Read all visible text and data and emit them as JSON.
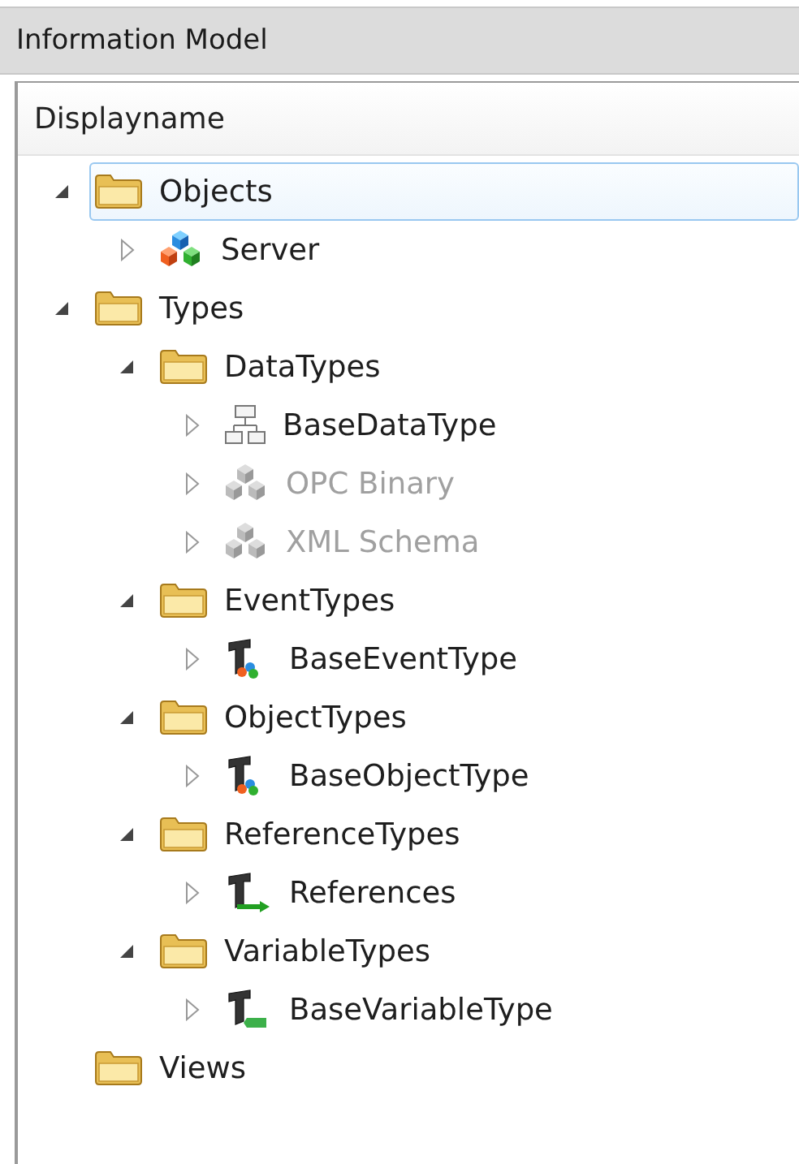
{
  "panel": {
    "title": "Information Model"
  },
  "tree": {
    "column": "Displayname",
    "items": [
      {
        "label": "Objects",
        "kind": "folder",
        "expanded": true,
        "selected": true,
        "disabled": false,
        "children": [
          {
            "label": "Server",
            "kind": "cubes",
            "expanded": false,
            "selected": false,
            "disabled": false
          }
        ]
      },
      {
        "label": "Types",
        "kind": "folder",
        "expanded": true,
        "selected": false,
        "disabled": false,
        "children": [
          {
            "label": "DataTypes",
            "kind": "folder",
            "expanded": true,
            "selected": false,
            "disabled": false,
            "children": [
              {
                "label": "BaseDataType",
                "kind": "hierarchy",
                "expanded": false,
                "selected": false,
                "disabled": false
              },
              {
                "label": "OPC Binary",
                "kind": "cubes",
                "expanded": false,
                "selected": false,
                "disabled": true
              },
              {
                "label": "XML Schema",
                "kind": "cubes",
                "expanded": false,
                "selected": false,
                "disabled": true
              }
            ]
          },
          {
            "label": "EventTypes",
            "kind": "folder",
            "expanded": true,
            "selected": false,
            "disabled": false,
            "children": [
              {
                "label": "BaseEventType",
                "kind": "type-cubes",
                "expanded": false,
                "selected": false,
                "disabled": false
              }
            ]
          },
          {
            "label": "ObjectTypes",
            "kind": "folder",
            "expanded": true,
            "selected": false,
            "disabled": false,
            "children": [
              {
                "label": "BaseObjectType",
                "kind": "type-cubes",
                "expanded": false,
                "selected": false,
                "disabled": false
              }
            ]
          },
          {
            "label": "ReferenceTypes",
            "kind": "folder",
            "expanded": true,
            "selected": false,
            "disabled": false,
            "children": [
              {
                "label": "References",
                "kind": "type-arrow",
                "expanded": false,
                "selected": false,
                "disabled": false
              }
            ]
          },
          {
            "label": "VariableTypes",
            "kind": "folder",
            "expanded": true,
            "selected": false,
            "disabled": false,
            "children": [
              {
                "label": "BaseVariableType",
                "kind": "type-tag",
                "expanded": false,
                "selected": false,
                "disabled": false
              }
            ]
          }
        ]
      },
      {
        "label": "Views",
        "kind": "folder",
        "selected": false,
        "disabled": false
      }
    ]
  }
}
